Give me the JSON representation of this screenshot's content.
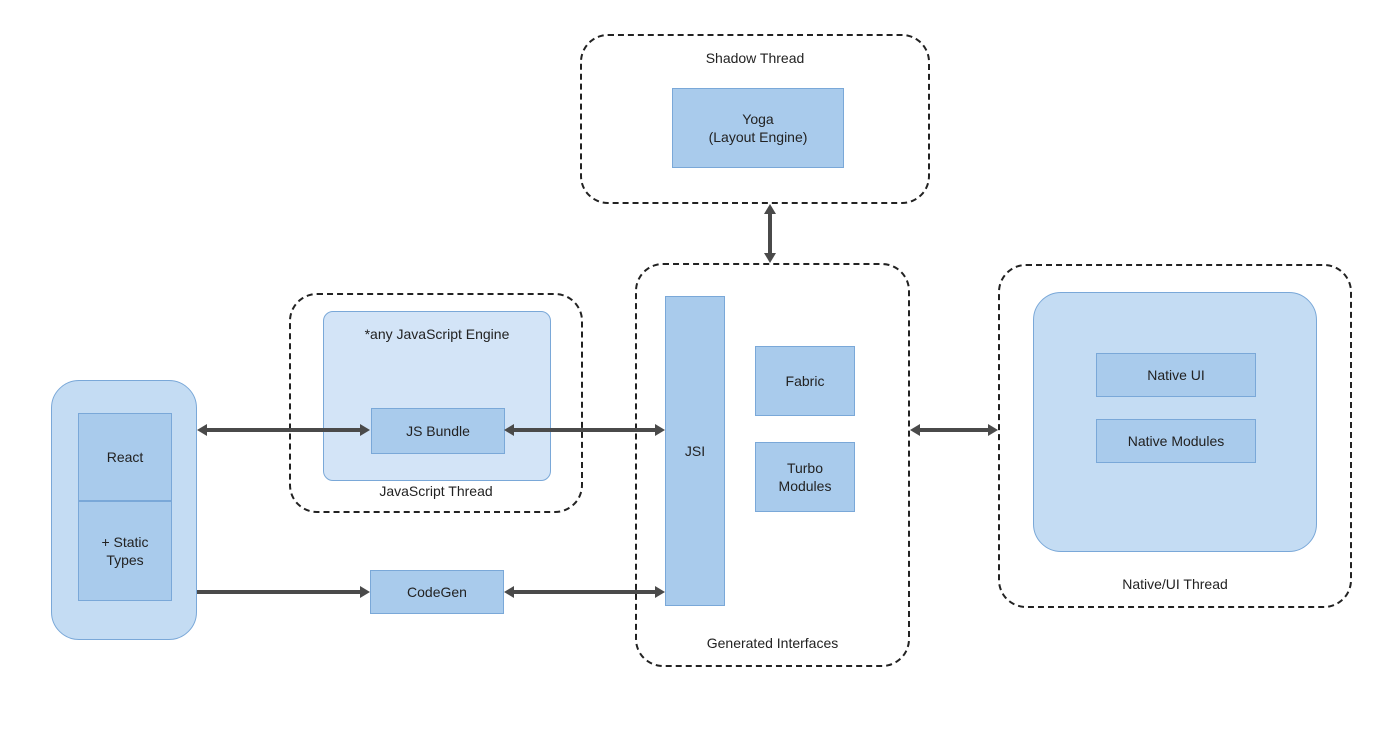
{
  "groups": {
    "shadow_thread": "Shadow Thread",
    "javascript_thread": "JavaScript Thread",
    "generated_interfaces": "Generated Interfaces",
    "native_ui_thread": "Native/UI Thread"
  },
  "containers": {
    "any_js_engine": "*any JavaScript Engine"
  },
  "boxes": {
    "react": "React",
    "static_types": "+ Static\nTypes",
    "js_bundle": "JS Bundle",
    "codegen": "CodeGen",
    "yoga": "Yoga\n(Layout Engine)",
    "jsi": "JSI",
    "fabric": "Fabric",
    "turbo_modules": "Turbo\nModules",
    "native_ui": "Native UI",
    "native_modules": "Native Modules"
  }
}
